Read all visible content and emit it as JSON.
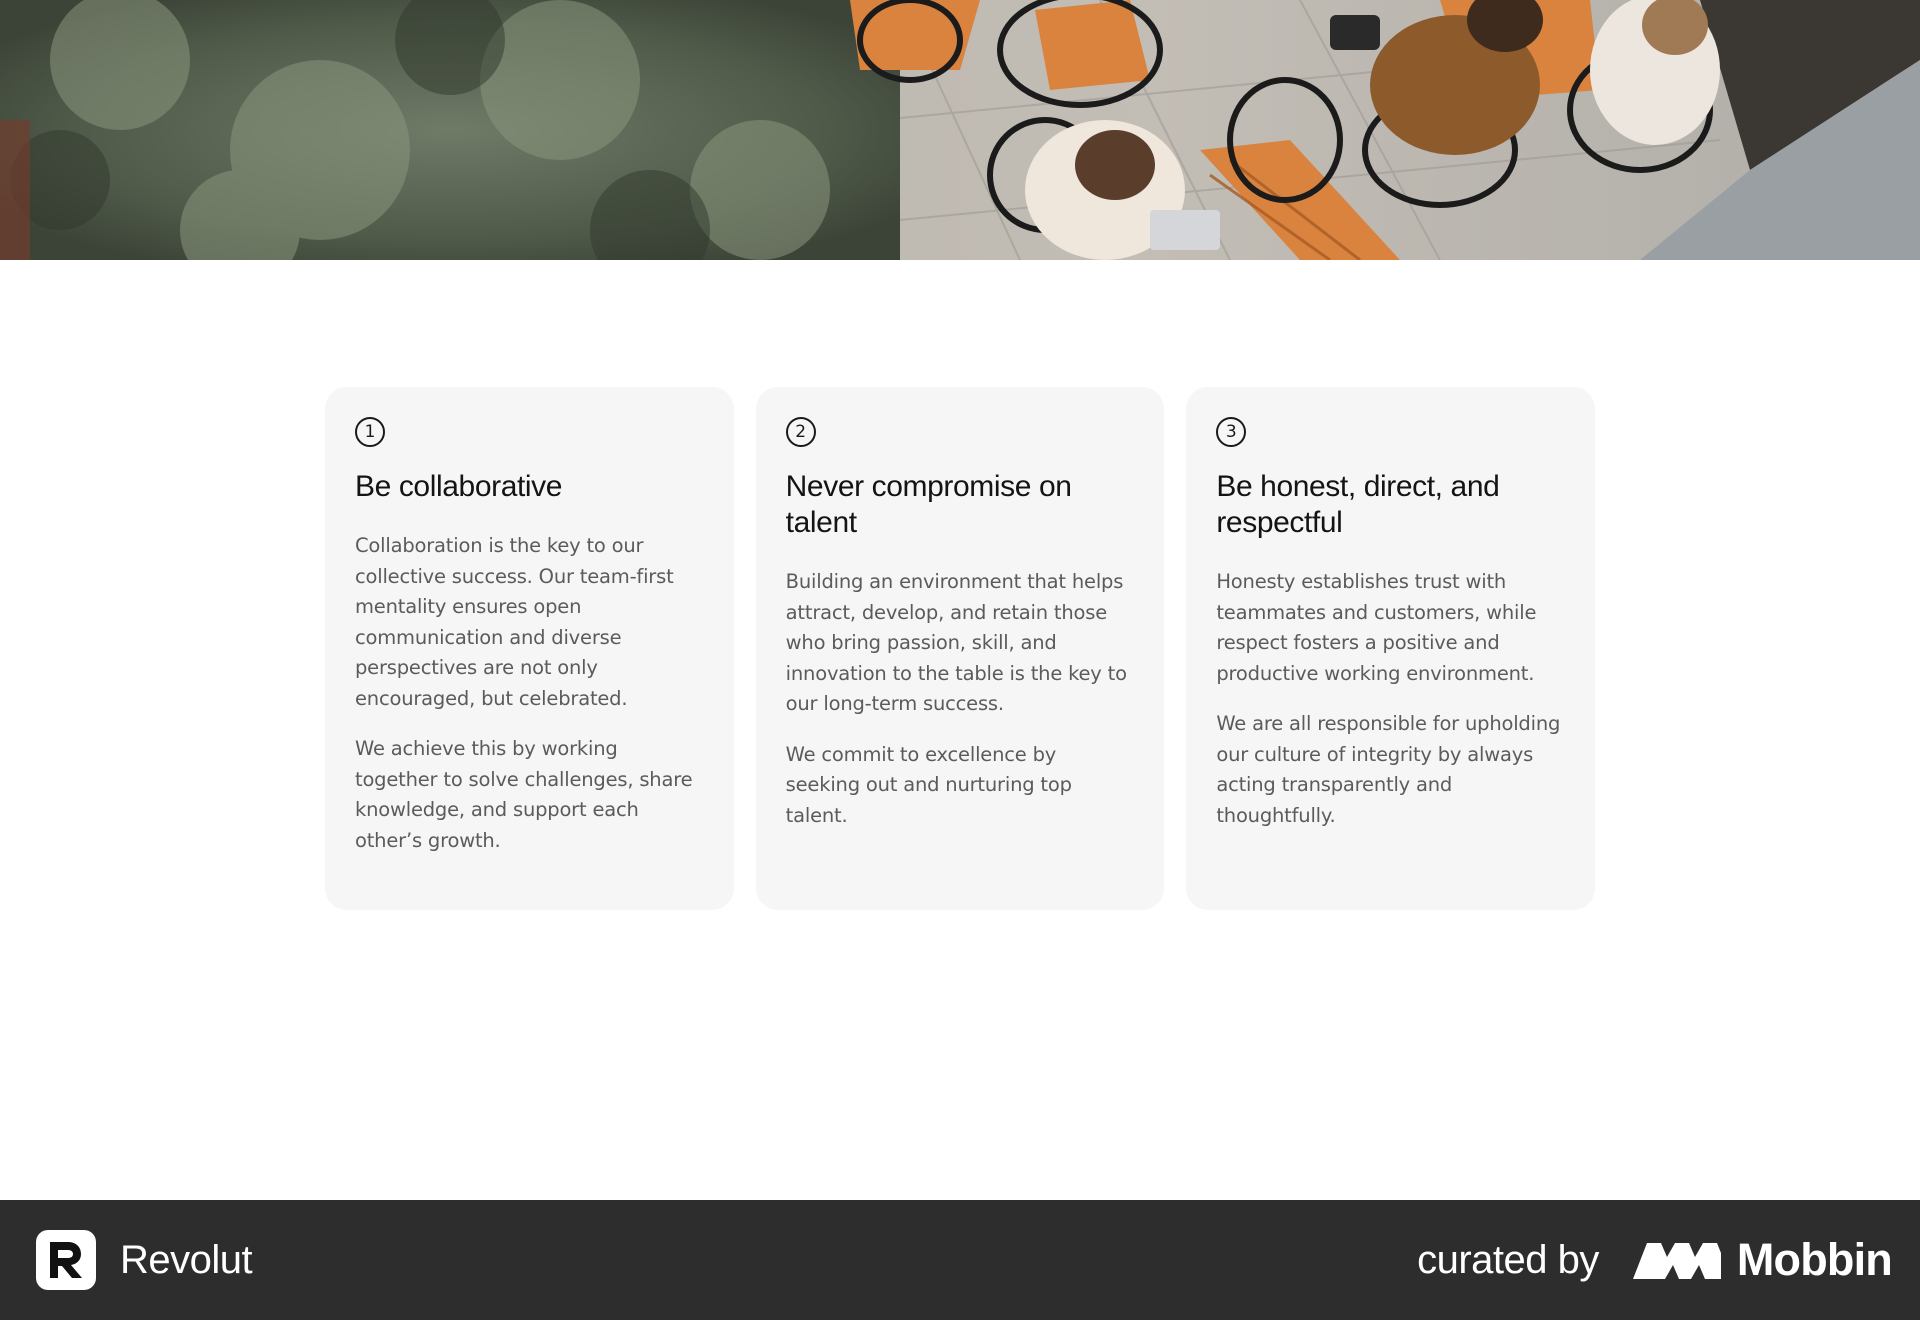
{
  "hero": {
    "icon": "office-courtyard-photo"
  },
  "values": [
    {
      "number": "1",
      "title": "Be collaborative",
      "paragraphs": [
        "Collaboration is the key to our collective success. Our team-first mentality ensures open communication and diverse perspectives are not only encouraged, but celebrated.",
        "We achieve this by working together to solve challenges, share knowledge, and support each other’s growth."
      ]
    },
    {
      "number": "2",
      "title": "Never compromise on talent",
      "paragraphs": [
        "Building an environment that helps attract, develop, and retain those who bring passion, skill, and innovation to the table is the key to our long-term success.",
        "We commit to excellence by seeking out and nurturing top talent."
      ]
    },
    {
      "number": "3",
      "title": "Be honest, direct, and respectful",
      "paragraphs": [
        "Honesty establishes trust with teammates and customers, while respect fosters a positive and productive working environment.",
        "We are all responsible for upholding our culture of integrity by always acting transparently and thoughtfully."
      ]
    }
  ],
  "footer": {
    "brand_name": "Revolut",
    "curated_label": "curated by",
    "curator_name": "Mobbin",
    "colors": {
      "background": "#2d2d2d",
      "text": "#ffffff"
    }
  }
}
